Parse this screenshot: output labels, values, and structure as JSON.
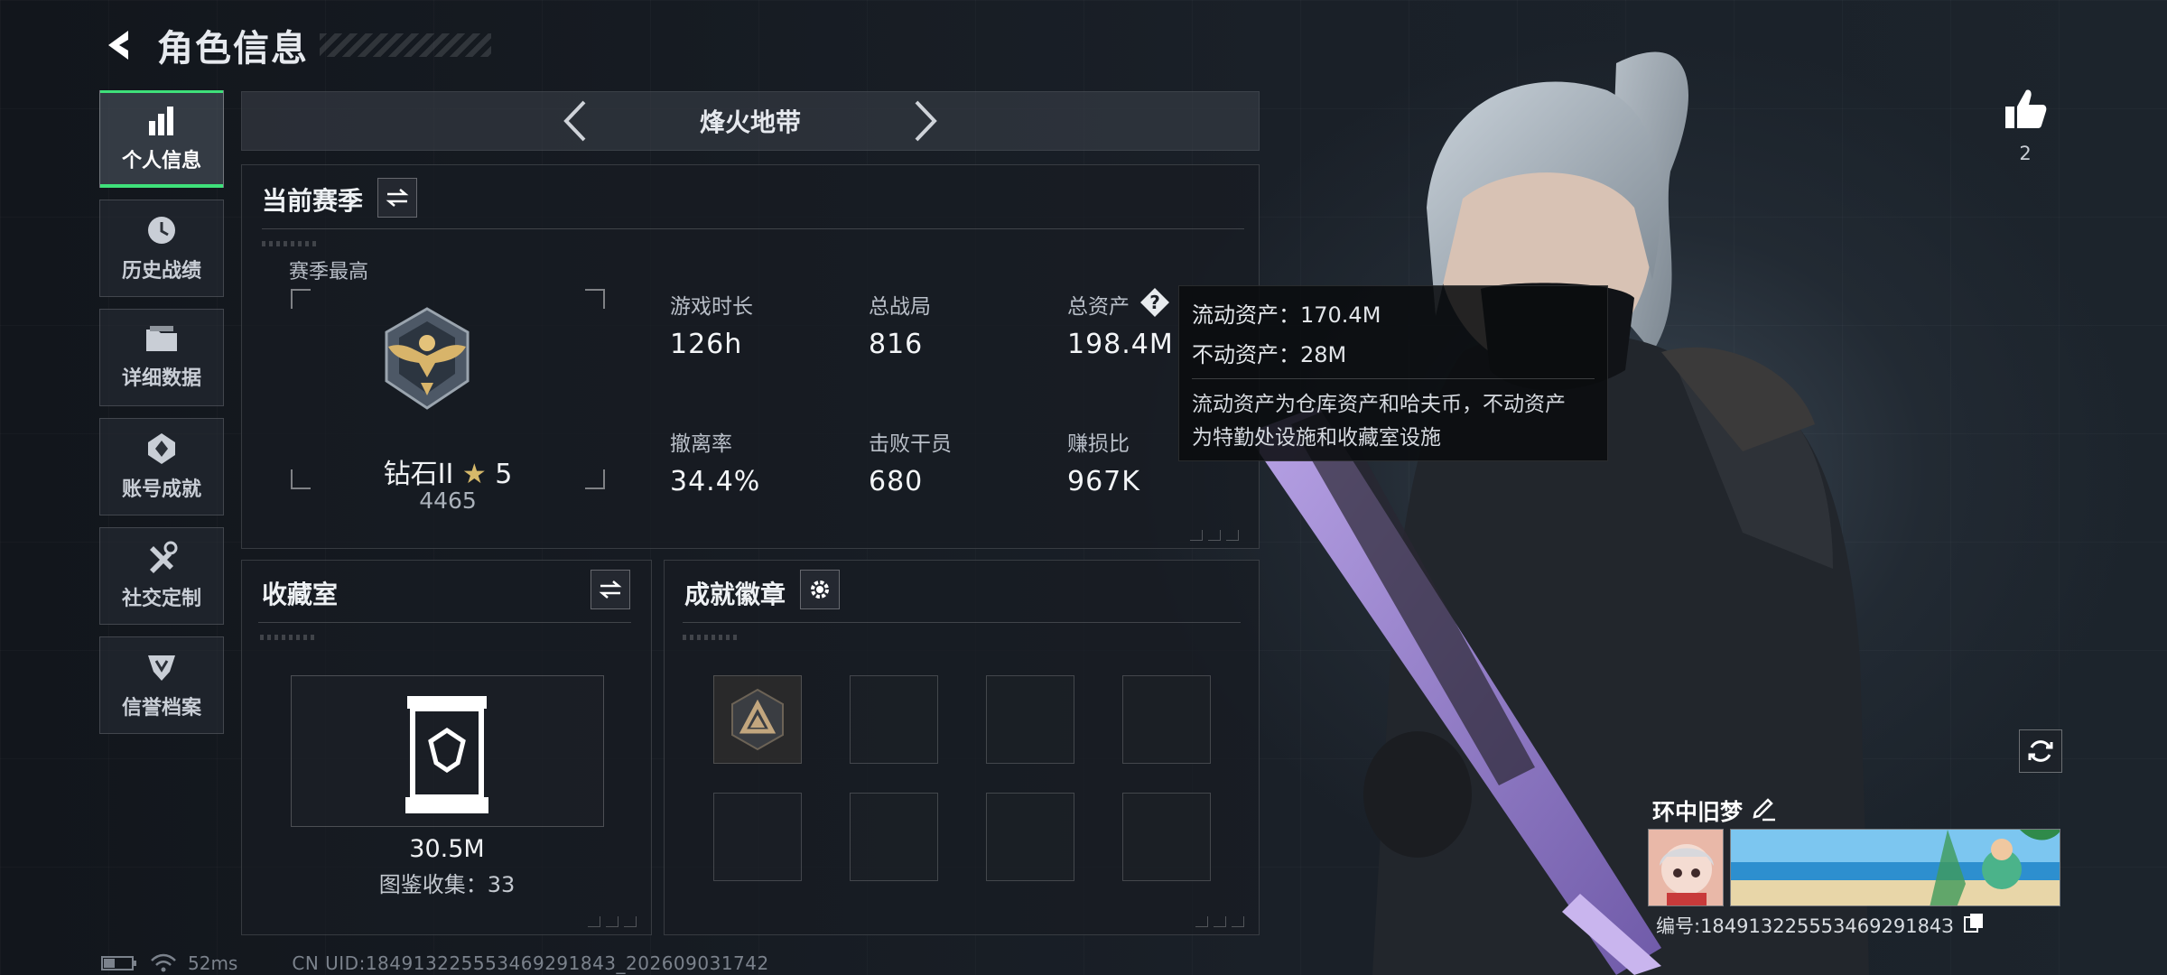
{
  "header": {
    "title": "角色信息"
  },
  "sidebar": {
    "items": [
      {
        "label": "个人信息",
        "icon": "bar-chart-icon",
        "active": true
      },
      {
        "label": "历史战绩",
        "icon": "history-icon",
        "active": false
      },
      {
        "label": "详细数据",
        "icon": "folder-icon",
        "active": false
      },
      {
        "label": "账号成就",
        "icon": "achievement-icon",
        "active": false
      },
      {
        "label": "社交定制",
        "icon": "tools-icon",
        "active": false
      },
      {
        "label": "信誉档案",
        "icon": "credit-icon",
        "active": false
      }
    ]
  },
  "mode": {
    "name": "烽火地带"
  },
  "season": {
    "title": "当前赛季",
    "best_label": "赛季最高",
    "rank_name": "钻石II",
    "rank_stars": "5",
    "rank_score": "4465",
    "stats": [
      {
        "label": "游戏时长",
        "value": "126h"
      },
      {
        "label": "总战局",
        "value": "816"
      },
      {
        "label": "总资产",
        "value": "198.4M"
      },
      {
        "label": "撤离率",
        "value": "34.4%"
      },
      {
        "label": "击败干员",
        "value": "680"
      },
      {
        "label": "赚损比",
        "value": "967K"
      }
    ]
  },
  "tooltip": {
    "liquid": "流动资产：170.4M",
    "fixed": "不动资产：28M",
    "desc_line1": "流动资产为仓库资产和哈夫币，不动资产",
    "desc_line2": "为特勤处设施和收藏室设施"
  },
  "collection": {
    "title": "收藏室",
    "value": "30.5M",
    "count_text": "图鉴收集：33"
  },
  "badges": {
    "title": "成就徽章"
  },
  "profile": {
    "likes": "2",
    "name": "环中旧梦",
    "id_text": "编号:18491322555346929184З"
  },
  "footer": {
    "ping": "52ms",
    "uid": "CN UID:184913225553469291843_202609031742"
  },
  "colors": {
    "accent": "#3fe07a",
    "panel_bg": "#181c22",
    "text": "#e6e9ee"
  }
}
